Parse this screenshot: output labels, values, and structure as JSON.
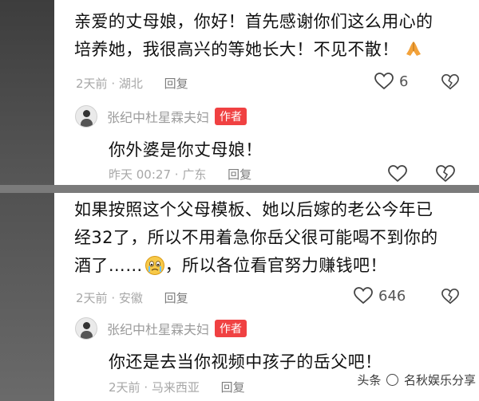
{
  "comments": [
    {
      "text_line1": "亲爱的丈母娘，你好！首先感谢你们这么用心的",
      "text_line2": "培养她，我很高兴的等她长大！不见不散！",
      "emoji": "pray-icon",
      "time": "2天前",
      "location": "湖北",
      "reply_label": "回复",
      "likes": "6",
      "author_reply": {
        "name": "张纪中杜星霖夫妇",
        "badge": "作者",
        "text": "你外婆是你丈母娘！",
        "time": "昨天 00:27",
        "location": "广东",
        "reply_label": "回复"
      }
    },
    {
      "text_line1": "如果按照这个父母模板、她以后嫁的老公今年已",
      "text_line2": "经32了，所以不用着急你岳父很可能喝不到你的",
      "text_line3a": "酒了……",
      "emoji": "crying-face-icon",
      "text_line3b": "，所以各位看官努力赚钱吧！",
      "time": "2天前",
      "location": "安徽",
      "reply_label": "回复",
      "likes": "646",
      "author_reply": {
        "name": "张纪中杜星霖夫妇",
        "badge": "作者",
        "text": "你还是去当你视频中孩子的岳父吧！",
        "time": "2天前",
        "location": "马来西亚",
        "reply_label": "回复"
      }
    }
  ],
  "watermark": {
    "prefix": "头条",
    "suffix": "名秋娱乐分享"
  }
}
